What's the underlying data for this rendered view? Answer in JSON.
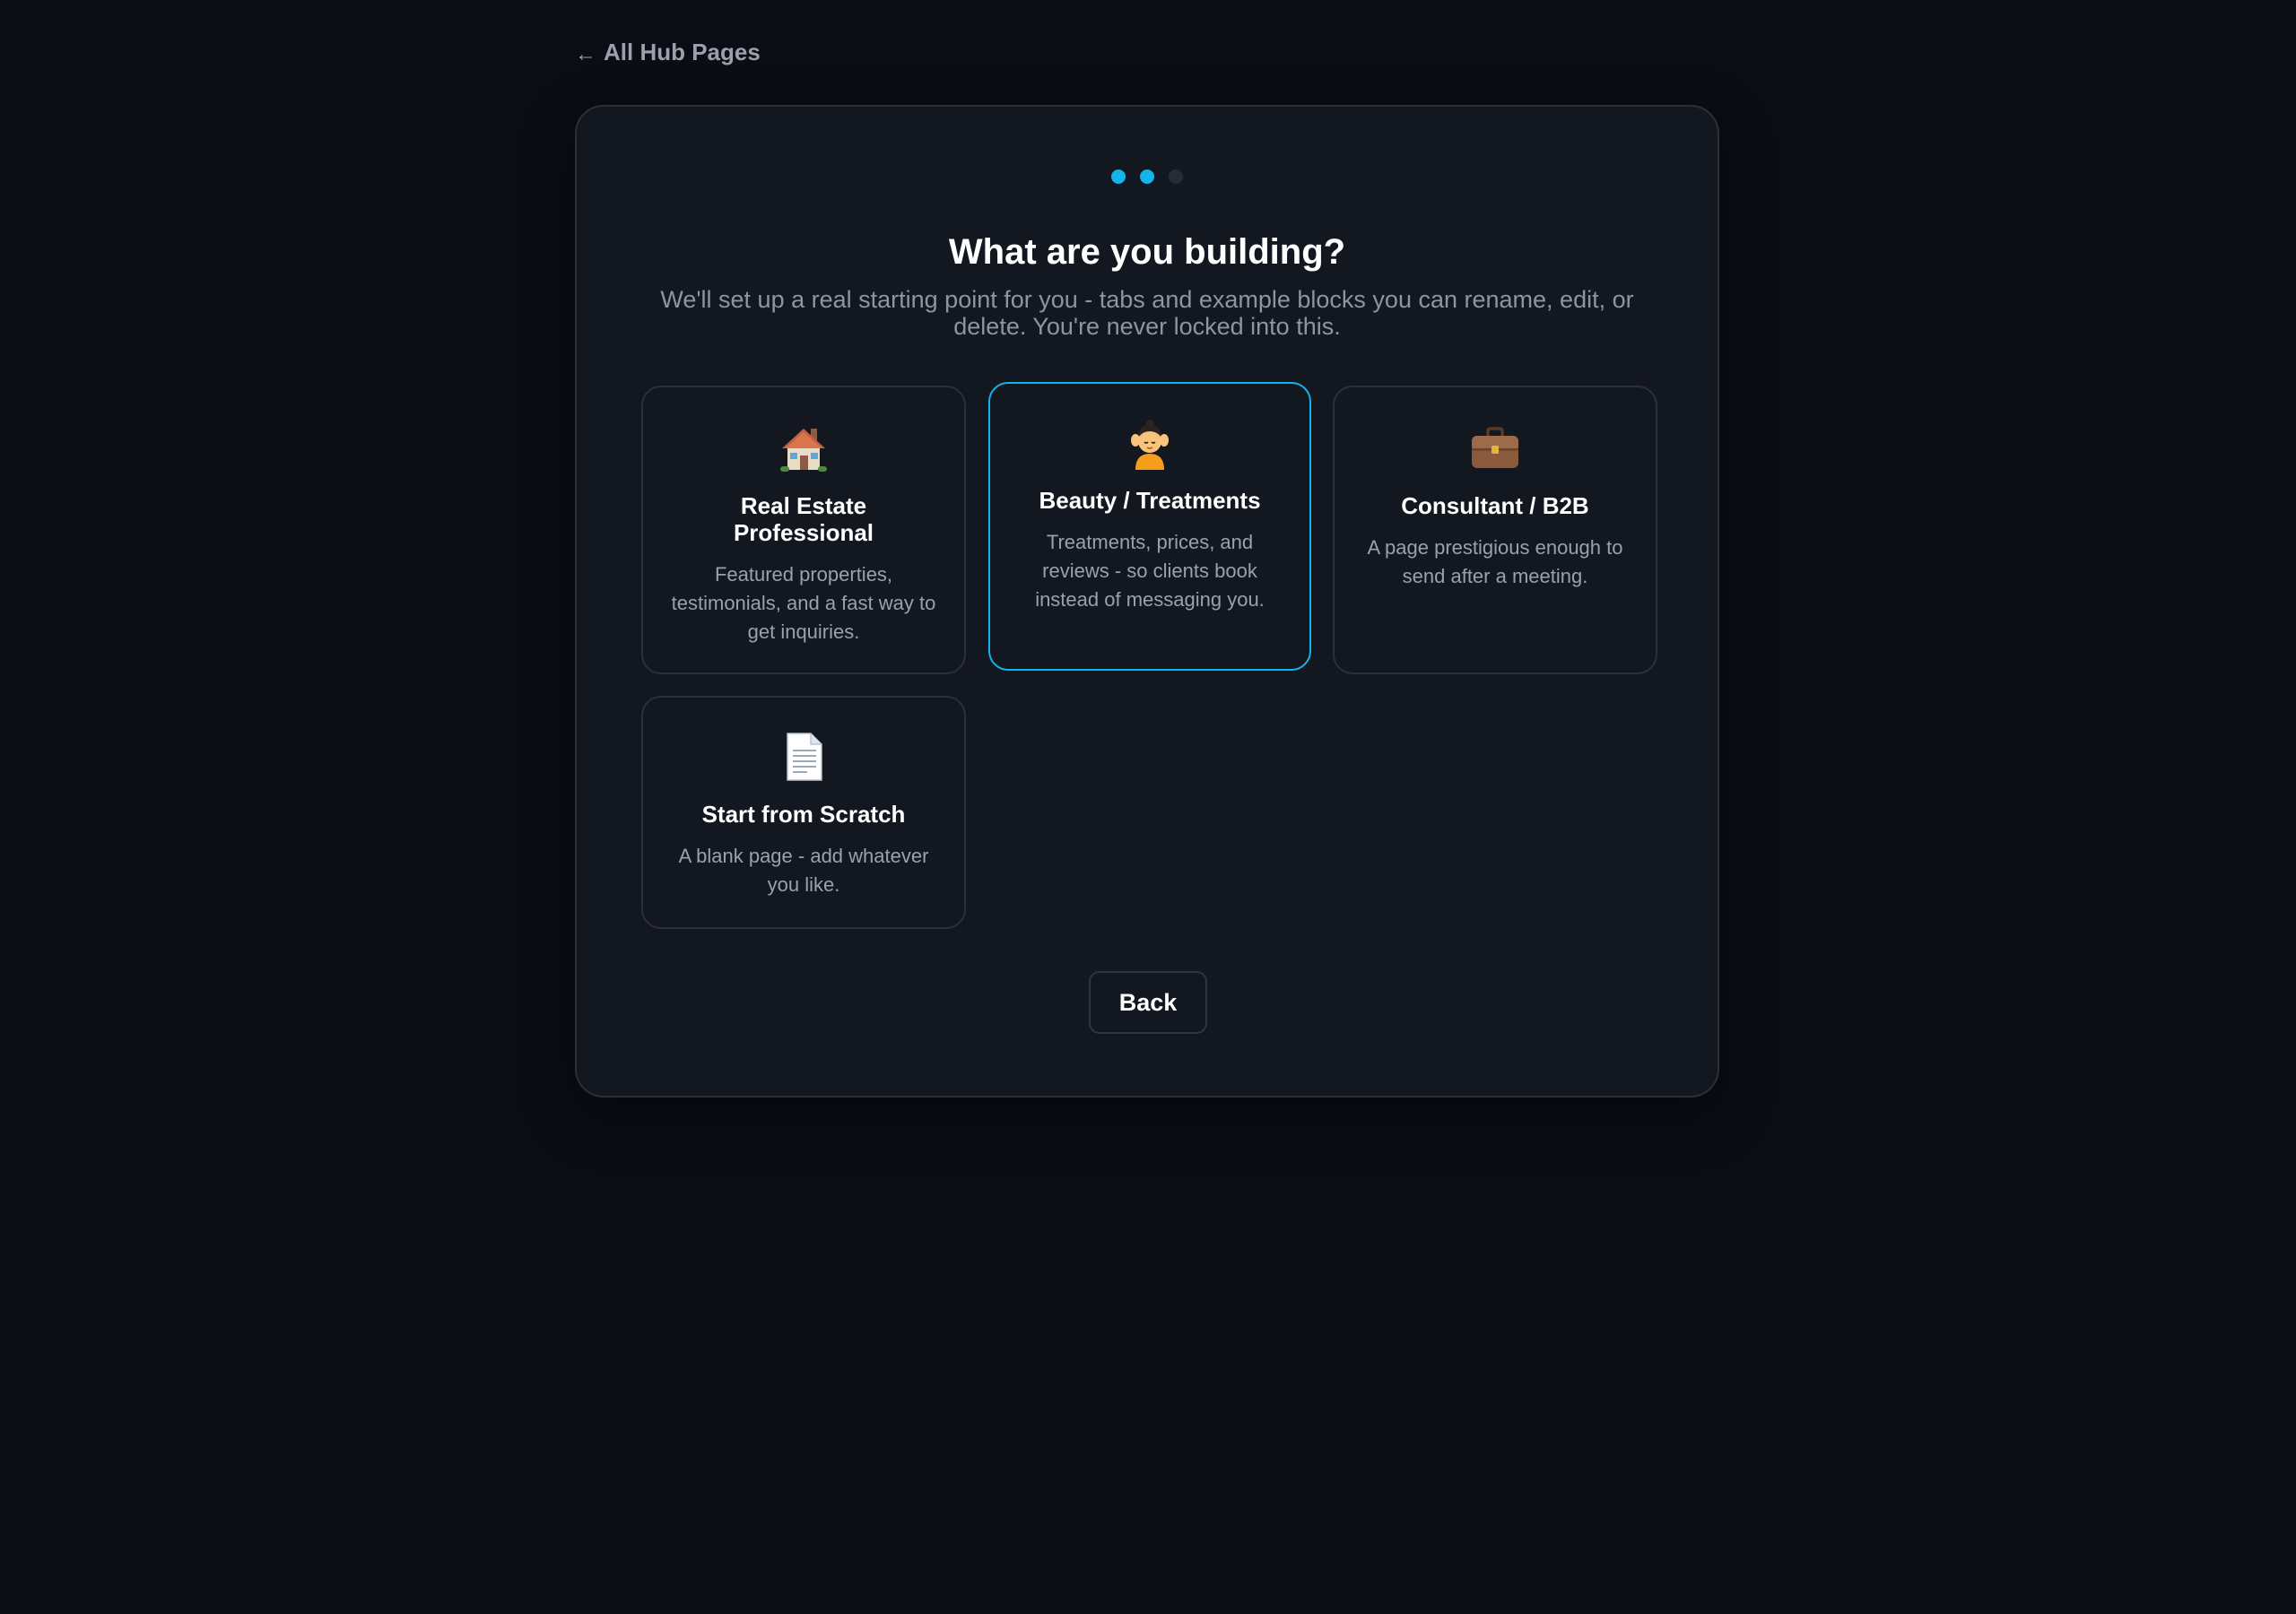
{
  "nav": {
    "back_arrow": "←",
    "back_label": "All Hub Pages"
  },
  "wizard": {
    "steps_total": 3,
    "steps_completed": 2,
    "title": "What are you building?",
    "subtitle": "We'll set up a real starting point for you - tabs and example blocks you can rename, edit, or delete. You're never locked into this."
  },
  "options": [
    {
      "icon": "house-icon",
      "title": "Real Estate Professional",
      "description": "Featured properties, testimonials, and a fast way to get inquiries.",
      "selected": false
    },
    {
      "icon": "massage-face-icon",
      "title": "Beauty / Treatments",
      "description": "Treatments, prices, and reviews - so clients book instead of messaging you.",
      "selected": true
    },
    {
      "icon": "briefcase-icon",
      "title": "Consultant / B2B",
      "description": "A page prestigious enough to send after a meeting.",
      "selected": false
    },
    {
      "icon": "document-icon",
      "title": "Start from Scratch",
      "description": "A blank page - add whatever you like.",
      "selected": false
    }
  ],
  "actions": {
    "back_label": "Back"
  },
  "colors": {
    "accent": "#13b5ea",
    "background": "#0a0d14",
    "card": "#131720",
    "muted_text": "#8d94a2"
  }
}
